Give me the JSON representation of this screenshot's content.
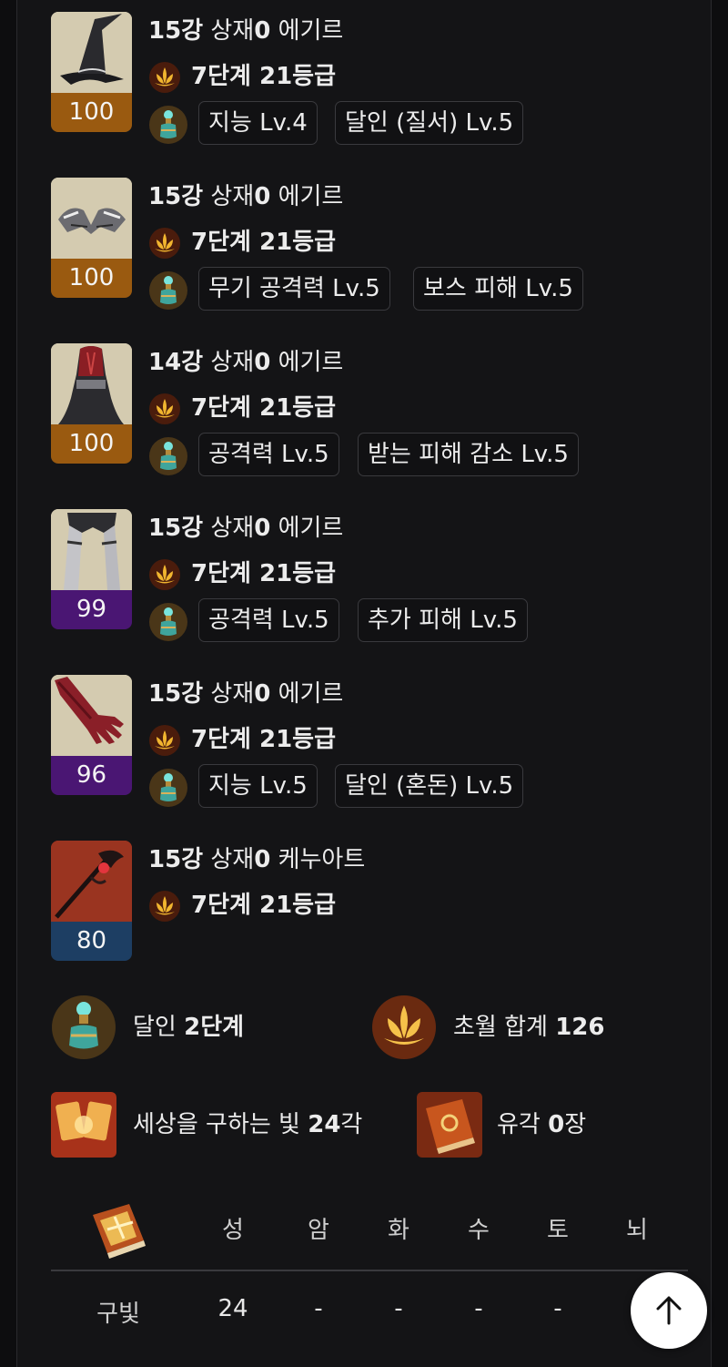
{
  "equipment": [
    {
      "slot": "hat",
      "enhance": "15강",
      "spacer": " 상재",
      "spacer_value": "0",
      "set": " 에기르",
      "quality": "100",
      "quality_color": "#9a5a10",
      "trans_stage": "7단계",
      "trans_grade": "21등급",
      "effects": [
        "지능 Lv.4",
        "달인 (질서) Lv.5"
      ]
    },
    {
      "slot": "shoulder",
      "enhance": "15강",
      "spacer": " 상재",
      "spacer_value": "0",
      "set": " 에기르",
      "quality": "100",
      "quality_color": "#9a5a10",
      "trans_stage": "7단계",
      "trans_grade": "21등급",
      "effects": [
        "무기 공격력 Lv.5",
        "보스 피해 Lv.5"
      ]
    },
    {
      "slot": "top",
      "enhance": "14강",
      "spacer": " 상재",
      "spacer_value": "0",
      "set": " 에기르",
      "quality": "100",
      "quality_color": "#9a5a10",
      "trans_stage": "7단계",
      "trans_grade": "21등급",
      "effects": [
        "공격력 Lv.5",
        "받는 피해 감소 Lv.5"
      ]
    },
    {
      "slot": "bottom",
      "enhance": "15강",
      "spacer": " 상재",
      "spacer_value": "0",
      "set": " 에기르",
      "quality": "99",
      "quality_color": "#4a1673",
      "trans_stage": "7단계",
      "trans_grade": "21등급",
      "effects": [
        "공격력 Lv.5",
        "추가 피해 Lv.5"
      ]
    },
    {
      "slot": "gloves",
      "enhance": "15강",
      "spacer": " 상재",
      "spacer_value": "0",
      "set": " 에기르",
      "quality": "96",
      "quality_color": "#4a1673",
      "trans_stage": "7단계",
      "trans_grade": "21등급",
      "effects": [
        "지능 Lv.5",
        "달인 (혼돈) Lv.5"
      ]
    },
    {
      "slot": "weapon",
      "enhance": "15강",
      "spacer": " 상재",
      "spacer_value": "0",
      "set": " 케누아트",
      "quality": "80",
      "quality_color": "#1d3e63",
      "trans_stage": "7단계",
      "trans_grade": "21등급",
      "effects": []
    }
  ],
  "summary": {
    "elixir": {
      "label": "달인 ",
      "value": "2단계"
    },
    "transcend": {
      "label": "초월 합계 ",
      "value": "126"
    },
    "card": {
      "label": "세상을 구하는 빛 ",
      "value": "24",
      "suffix": "각"
    },
    "relic_book": {
      "label": "유각 ",
      "value": "0",
      "suffix": "장"
    }
  },
  "card_table": {
    "headers": [
      "성",
      "암",
      "화",
      "수",
      "토",
      "뇌"
    ],
    "row_label": "구빛",
    "row_values": [
      "24",
      "-",
      "-",
      "-",
      "-"
    ]
  },
  "icons": {
    "transcend": "lotus-flame-icon",
    "elixir": "elixir-flask-icon",
    "card": "awakening-card-icon",
    "book": "engraving-book-icon",
    "scroll_top": "arrow-up-icon"
  }
}
